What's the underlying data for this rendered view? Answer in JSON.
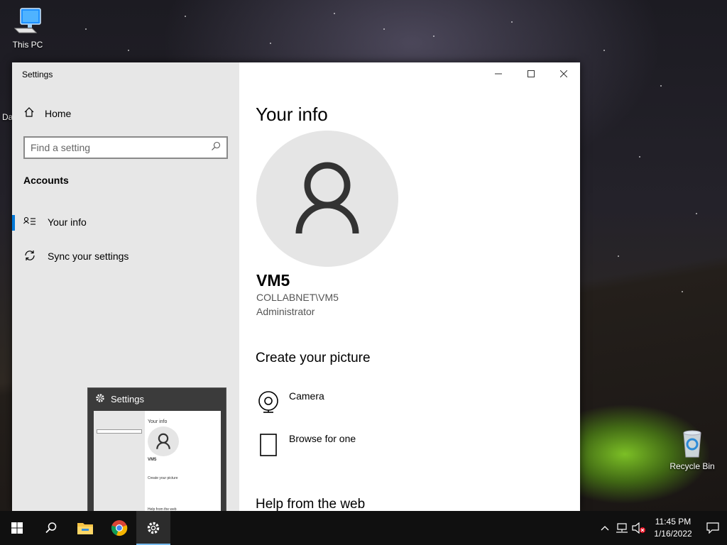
{
  "desktop": {
    "icons": [
      {
        "label": "This PC"
      },
      {
        "label": "Recycle Bin"
      }
    ],
    "partial_label": "Da"
  },
  "window": {
    "title": "Settings",
    "sidebar": {
      "home_label": "Home",
      "search_placeholder": "Find a setting",
      "section_title": "Accounts",
      "items": [
        {
          "label": "Your info",
          "selected": true,
          "icon": "contact-card-icon"
        },
        {
          "label": "Sync your settings",
          "selected": false,
          "icon": "sync-icon"
        }
      ]
    },
    "main": {
      "page_title": "Your info",
      "user": {
        "name": "VM5",
        "domain": "COLLABNET\\VM5",
        "role": "Administrator"
      },
      "create_picture_title": "Create your picture",
      "options": [
        {
          "label": "Camera",
          "icon": "camera-icon"
        },
        {
          "label": "Browse for one",
          "icon": "document-icon"
        }
      ],
      "help_title": "Help from the web"
    }
  },
  "taskbar_preview": {
    "title": "Settings",
    "thumb": {
      "page_title": "Your info",
      "user_name": "VM5",
      "create_title": "Create your picture",
      "help_title": "Help from the web"
    }
  },
  "taskbar": {
    "apps": [
      {
        "name": "file-explorer"
      },
      {
        "name": "chrome"
      },
      {
        "name": "settings",
        "active": true
      }
    ],
    "clock": {
      "time": "11:45 PM",
      "date": "1/16/2022"
    }
  },
  "colors": {
    "accent": "#0078d7",
    "sidebar_bg": "#e7e7e7",
    "taskbar_bg": "#101010"
  }
}
